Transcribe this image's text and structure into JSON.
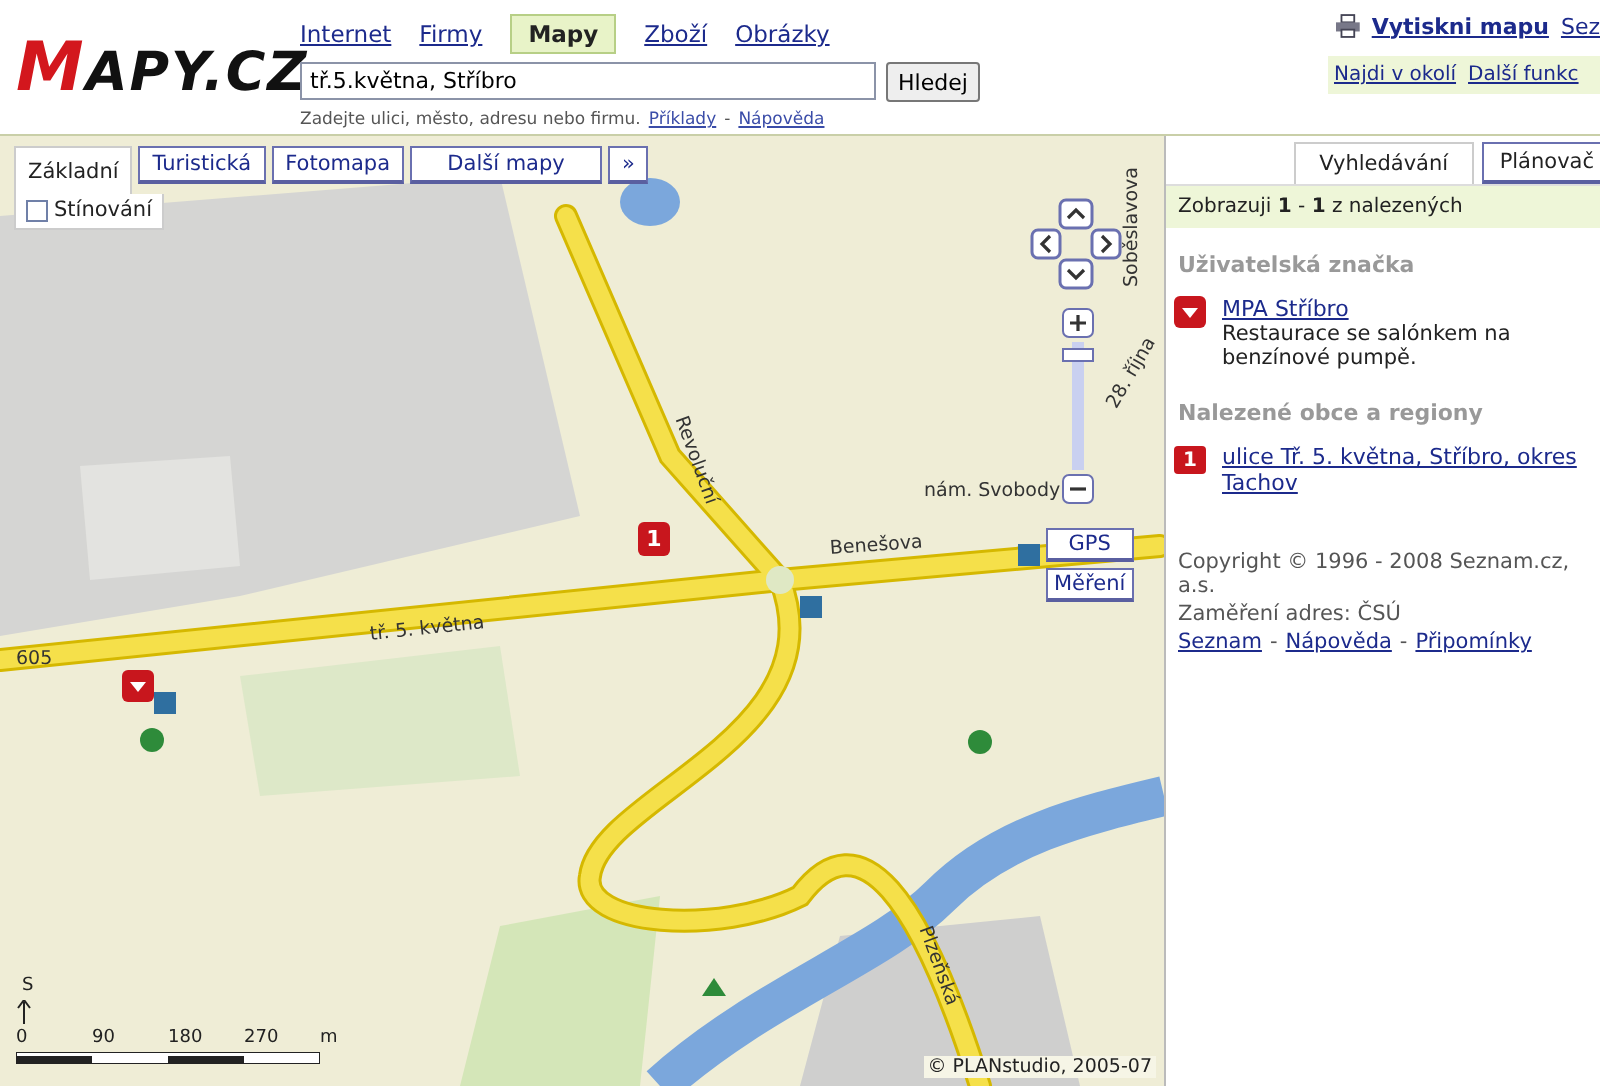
{
  "header": {
    "logo": "MAPY.CZ",
    "nav": [
      {
        "label": "Internet",
        "selected": false
      },
      {
        "label": "Firmy",
        "selected": false
      },
      {
        "label": "Mapy",
        "selected": true
      },
      {
        "label": "Zboží",
        "selected": false
      },
      {
        "label": "Obrázky",
        "selected": false
      }
    ],
    "search": {
      "value": "tř.5.května, Stříbro",
      "button": "Hledej",
      "hint": "Zadejte ulici, město, adresu nebo firmu.",
      "links": [
        "Příklady",
        "Nápověda"
      ],
      "separator": "-"
    },
    "print": "Vytiskni mapu",
    "cut_link": "Sez",
    "tools": [
      "Najdi v okolí",
      "Další funkc"
    ]
  },
  "map": {
    "layers": [
      {
        "label": "Základní",
        "selected": true
      },
      {
        "label": "Turistická",
        "selected": false
      },
      {
        "label": "Fotomapa",
        "selected": false
      },
      {
        "label": "Další mapy",
        "selected": false
      }
    ],
    "more": "»",
    "shading": {
      "label": "Stínování",
      "checked": false
    },
    "zoom": {
      "level": 0.95
    },
    "tools": [
      "GPS",
      "Měření"
    ],
    "streets": [
      "tř. 5. května",
      "Benešova",
      "Revoluční",
      "28. října",
      "Soběslavova",
      "nám. Svobody",
      "Plzeňská",
      "605"
    ],
    "markers": [
      {
        "kind": "numbered",
        "label": "1"
      },
      {
        "kind": "user"
      }
    ],
    "scale": {
      "north": "S",
      "ticks": [
        "0",
        "90",
        "180",
        "270",
        "m"
      ]
    },
    "copyright": "© PLANstudio, 2005-07"
  },
  "sidebar": {
    "tabs": [
      {
        "label": "Vyhledávání",
        "selected": true
      },
      {
        "label": "Plánovač",
        "selected": false
      }
    ],
    "summary": "Zobrazuji **1** - **1** z nalezených",
    "sections": [
      {
        "title": "Uživatelská značka",
        "items": [
          {
            "kind": "user",
            "title": "MPA Stříbro",
            "description": "Restaurace se salónkem na benzínové pumpě."
          }
        ]
      },
      {
        "title": "Nalezené obce a regiony",
        "items": [
          {
            "kind": "numbered",
            "badge": "1",
            "title": "ulice Tř. 5. května, Stříbro, okres Tachov"
          }
        ]
      }
    ],
    "copyright": [
      "Copyright © 1996 - 2008 Seznam.cz, a.s.",
      "Zaměření adres: ČSÚ"
    ],
    "links": [
      "Seznam",
      "Nápověda",
      "Připomínky"
    ],
    "separator": "-"
  }
}
